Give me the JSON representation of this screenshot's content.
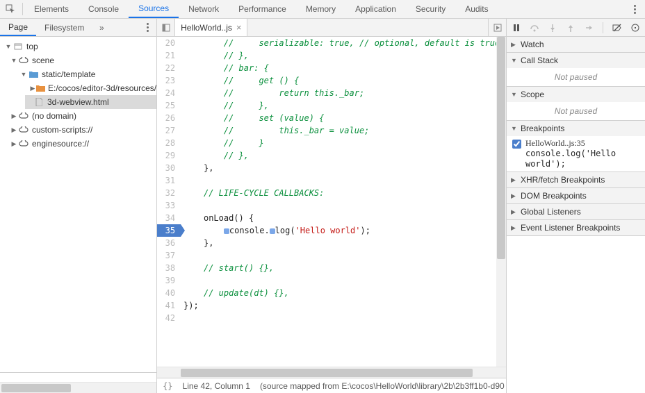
{
  "top_tabs": {
    "elements": "Elements",
    "console": "Console",
    "sources": "Sources",
    "network": "Network",
    "performance": "Performance",
    "memory": "Memory",
    "application": "Application",
    "security": "Security",
    "audits": "Audits"
  },
  "left": {
    "page_tab": "Page",
    "filesystem_tab": "Filesystem",
    "more_glyph": "»"
  },
  "tree": {
    "top": "top",
    "scene": "scene",
    "static_template": "static/template",
    "resources_path": "E:/cocos/editor-3d/resources/",
    "webview_file": "3d-webview.html",
    "no_domain": "(no domain)",
    "custom_scripts": "custom-scripts://",
    "enginesource": "enginesource://"
  },
  "editor": {
    "tab_name": "HelloWorld..js",
    "line_numbers": [
      "20",
      "21",
      "22",
      "23",
      "24",
      "25",
      "26",
      "27",
      "28",
      "29",
      "30",
      "31",
      "32",
      "33",
      "34",
      "35",
      "36",
      "37",
      "38",
      "39",
      "40",
      "41",
      "42"
    ],
    "bp_line_index": 15,
    "lines": {
      "l20": "        //     serializable: true, // optional, default is true",
      "l21": "        // },",
      "l22": "        // bar: {",
      "l23": "        //     get () {",
      "l24": "        //         return this._bar;",
      "l25": "        //     },",
      "l26": "        //     set (value) {",
      "l27": "        //         this._bar = value;",
      "l28": "        //     }",
      "l29": "        // },",
      "l30": "    },",
      "l32": "    // LIFE-CYCLE CALLBACKS:",
      "l34_pre": "    onLoad() {",
      "l35_a": "        ",
      "l35_b": "console.",
      "l35_c": "log(",
      "l35_str": "'Hello world'",
      "l35_d": ");",
      "l36": "    },",
      "l38": "    // start() {},",
      "l40": "    // update(dt) {},",
      "l41": "});"
    }
  },
  "status": {
    "braces_symbol": "{}",
    "cursor": "Line 42, Column 1",
    "mapped": "(source mapped from E:\\cocos\\HelloWorld\\library\\2b\\2b3ff1b0-d90"
  },
  "right": {
    "watch": "Watch",
    "call_stack": "Call Stack",
    "not_paused": "Not paused",
    "scope": "Scope",
    "breakpoints": "Breakpoints",
    "bp_file": "HelloWorld..js:35",
    "bp_src": "console.log('Hello world');",
    "xhr_bp": "XHR/fetch Breakpoints",
    "dom_bp": "DOM Breakpoints",
    "global_listeners": "Global Listeners",
    "event_bp": "Event Listener Breakpoints"
  }
}
